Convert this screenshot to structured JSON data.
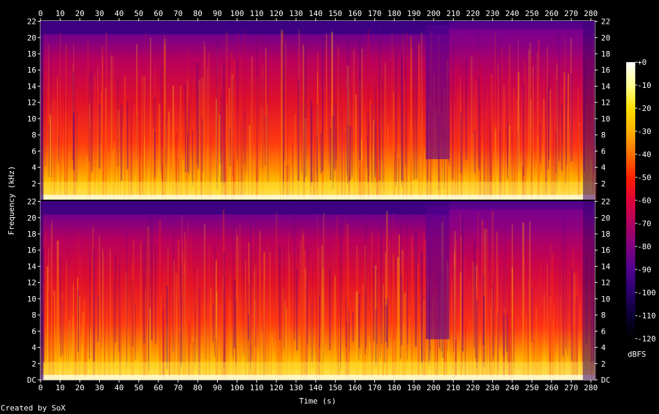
{
  "chart_data": {
    "type": "heatmap",
    "title": "",
    "xlabel": "Time (s)",
    "ylabel": "Frequency (kHz)",
    "xlim": [
      0,
      282
    ],
    "ylim": [
      0,
      22.05
    ],
    "x_ticks": [
      0,
      10,
      20,
      30,
      40,
      50,
      60,
      70,
      80,
      90,
      100,
      110,
      120,
      130,
      140,
      150,
      160,
      170,
      180,
      190,
      200,
      210,
      220,
      230,
      240,
      250,
      260,
      270,
      280
    ],
    "y_ticks_top": [
      "22",
      "20",
      "18",
      "16",
      "14",
      "12",
      "10",
      "8",
      "6",
      "4",
      "2"
    ],
    "y_ticks_bottom": [
      "22",
      "20",
      "18",
      "16",
      "14",
      "12",
      "10",
      "8",
      "6",
      "4",
      "2",
      "DC"
    ],
    "channels": 2,
    "colorbar": {
      "label": "dBFS",
      "ticks": [
        "+0",
        "-10",
        "-20",
        "-30",
        "-40",
        "-50",
        "-60",
        "-70",
        "-80",
        "-90",
        "-100",
        "-110",
        "-120"
      ],
      "stops": [
        "#ffffff",
        "#ffff90",
        "#ffe000",
        "#ffb000",
        "#ff7000",
        "#ff2000",
        "#e0003a",
        "#b00060",
        "#800080",
        "#500090",
        "#28006c",
        "#0a0030",
        "#000000"
      ]
    },
    "features": [
      {
        "note": "quieter section",
        "x_range": [
          196,
          208
        ]
      },
      {
        "note": "reduced high-frequency cutoff",
        "x_range": [
          0,
          208
        ],
        "freq_kHz": 20.4
      },
      {
        "note": "fade-out",
        "x_range": [
          275,
          282
        ]
      }
    ]
  },
  "credit": "Created by SoX"
}
